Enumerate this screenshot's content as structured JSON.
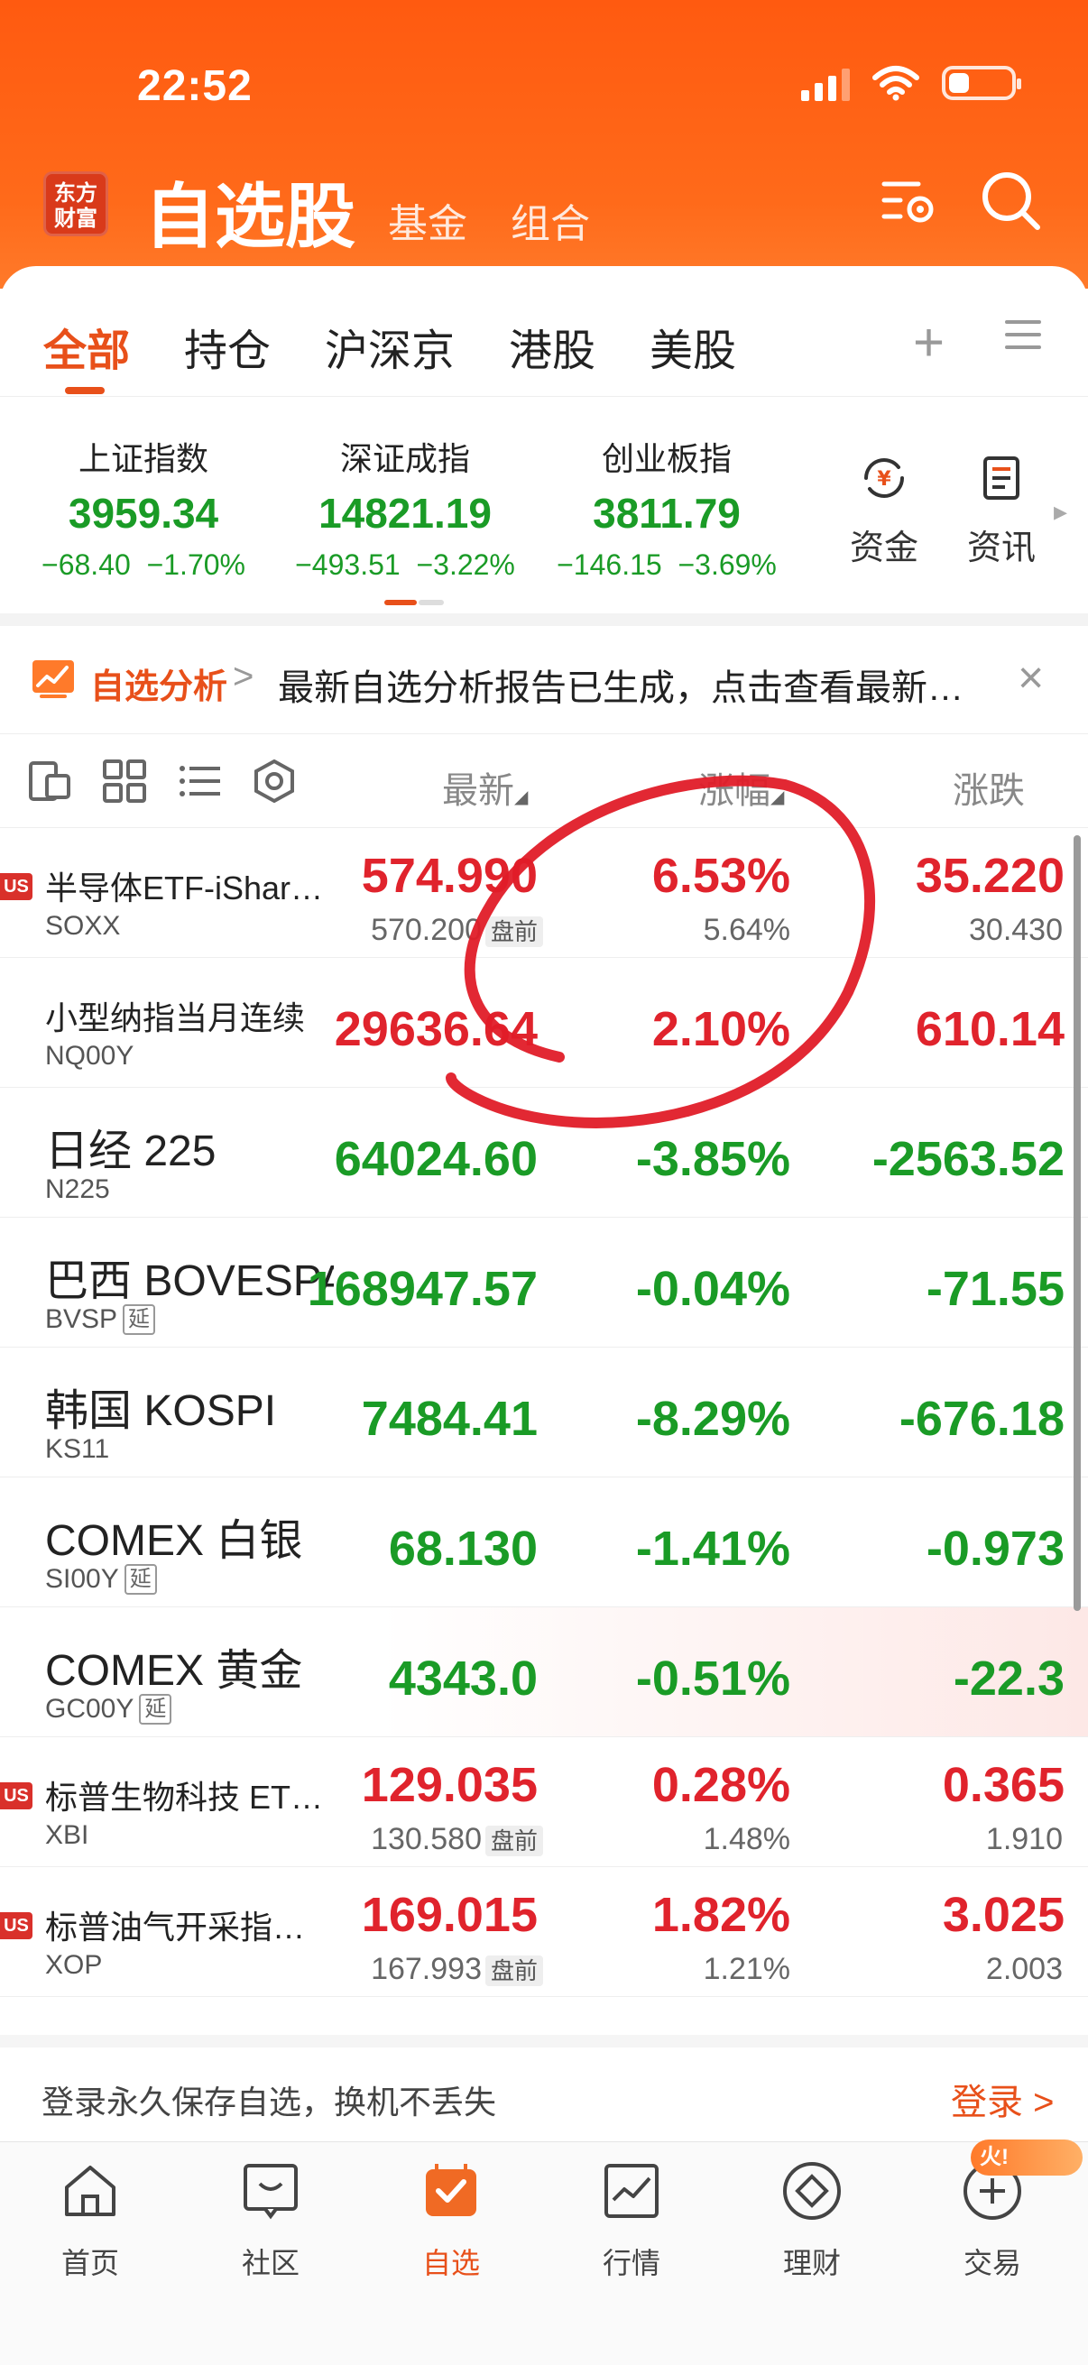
{
  "status_bar": {
    "time": "22:52"
  },
  "header": {
    "logo_text_line1": "东方",
    "logo_text_line2": "财富",
    "title": "自选股",
    "sub_tabs": [
      "基金",
      "组合"
    ],
    "icons": [
      "settings-list-icon",
      "search-icon"
    ]
  },
  "tabs": {
    "items": [
      "全部",
      "持仓",
      "沪深京",
      "港股",
      "美股"
    ],
    "active": "全部",
    "plus_symbol": "+"
  },
  "indices": [
    {
      "name": "上证指数",
      "value": "3959.34",
      "change": "−68.40",
      "percent": "−1.70%"
    },
    {
      "name": "深证成指",
      "value": "14821.19",
      "change": "−493.51",
      "percent": "−3.22%"
    },
    {
      "name": "创业板指",
      "value": "3811.79",
      "change": "−146.15",
      "percent": "−3.69%"
    }
  ],
  "tools": [
    {
      "label": "资金",
      "icon": "capital-flow-icon",
      "glyph": "¥"
    },
    {
      "label": "资讯",
      "icon": "news-icon"
    }
  ],
  "banner": {
    "tag": "自选分析",
    "chevron": ">",
    "text": "最新自选分析报告已生成，点击查看最新…",
    "close": "×"
  },
  "list_header": {
    "columns": [
      "最新",
      "涨幅",
      "涨跌"
    ]
  },
  "rows": [
    {
      "badge": "US",
      "name": "半导体ETF-iShar…",
      "code": "SOXX",
      "price": "574.990",
      "pct": "6.53%",
      "chg": "35.220",
      "color": "red",
      "pre_price": "570.200",
      "pre_label": "盘前",
      "pre_pct": "5.64%",
      "pre_chg": "30.430",
      "name_size": "small"
    },
    {
      "name": "小型纳指当月连续",
      "code": "NQ00Y",
      "price": "29636.64",
      "pct": "2.10%",
      "chg": "610.14",
      "color": "red",
      "name_size": "small"
    },
    {
      "name": "日经 225",
      "code": "N225",
      "price": "64024.60",
      "pct": "-3.85%",
      "chg": "-2563.52",
      "color": "green",
      "name_size": "big"
    },
    {
      "name": "巴西 BOVESPA",
      "code": "BVSP",
      "delay": "延",
      "price": "168947.57",
      "pct": "-0.04%",
      "chg": "-71.55",
      "color": "green",
      "name_size": "big"
    },
    {
      "name": "韩国 KOSPI",
      "code": "KS11",
      "price": "7484.41",
      "pct": "-8.29%",
      "chg": "-676.18",
      "color": "green",
      "name_size": "big"
    },
    {
      "name": "COMEX 白银",
      "code": "SI00Y",
      "delay": "延",
      "price": "68.130",
      "pct": "-1.41%",
      "chg": "-0.973",
      "color": "green",
      "name_size": "big"
    },
    {
      "name": "COMEX 黄金",
      "code": "GC00Y",
      "delay": "延",
      "price": "4343.0",
      "pct": "-0.51%",
      "chg": "-22.3",
      "color": "green",
      "name_size": "big",
      "highlight": true
    },
    {
      "badge": "US",
      "name": "标普生物科技 ET…",
      "code": "XBI",
      "price": "129.035",
      "pct": "0.28%",
      "chg": "0.365",
      "color": "red",
      "pre_price": "130.580",
      "pre_label": "盘前",
      "pre_pct": "1.48%",
      "pre_chg": "1.910",
      "name_size": "small"
    },
    {
      "badge": "US",
      "name": "标普油气开采指…",
      "code": "XOP",
      "price": "169.015",
      "pct": "1.82%",
      "chg": "3.025",
      "color": "red",
      "pre_price": "167.993",
      "pre_label": "盘前",
      "pre_pct": "1.21%",
      "pre_chg": "2.003",
      "name_size": "small"
    }
  ],
  "login": {
    "text": "登录永久保存自选，换机不丢失",
    "button": "登录 >"
  },
  "nav": {
    "items": [
      {
        "label": "首页",
        "icon": "home-icon"
      },
      {
        "label": "社区",
        "icon": "community-icon"
      },
      {
        "label": "自选",
        "icon": "watchlist-icon"
      },
      {
        "label": "行情",
        "icon": "market-chart-icon"
      },
      {
        "label": "理财",
        "icon": "wealth-icon"
      },
      {
        "label": "交易",
        "icon": "trade-icon"
      }
    ],
    "active": "自选",
    "hot_badge": "火!"
  },
  "colors": {
    "brand_orange": "#ff5a10",
    "up_red": "#e0232c",
    "down_green": "#1a9b26",
    "accent": "#e8501a"
  }
}
